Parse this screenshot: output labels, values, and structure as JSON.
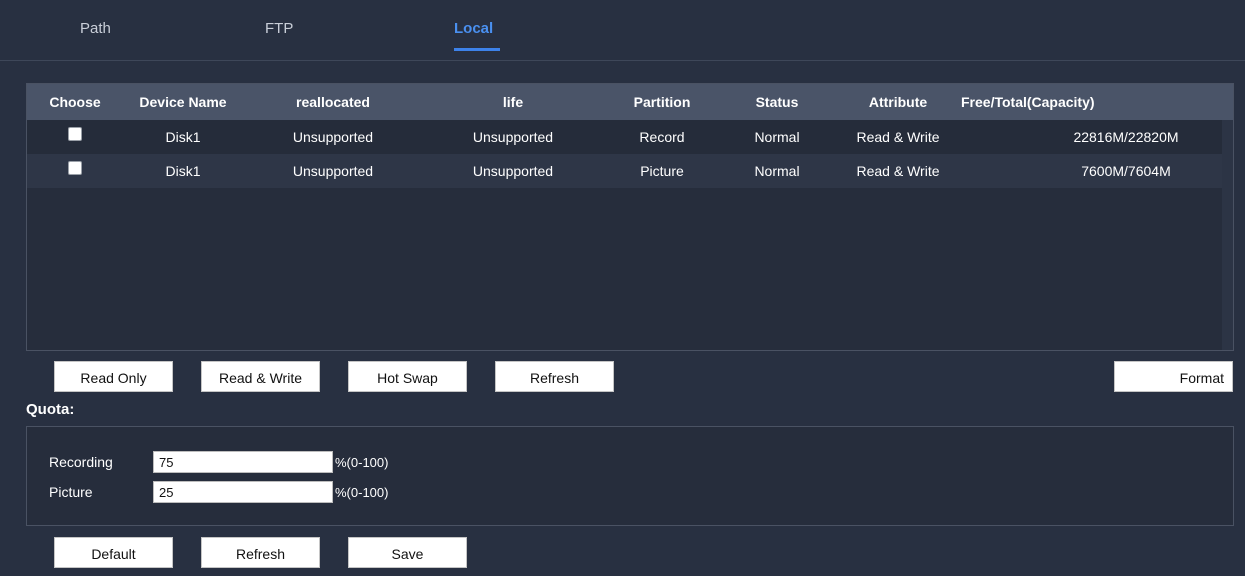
{
  "tabs": [
    {
      "label": "Path",
      "active": false
    },
    {
      "label": "FTP",
      "active": false
    },
    {
      "label": "Local",
      "active": true
    }
  ],
  "table": {
    "headers": [
      "Choose",
      "Device Name",
      "reallocated",
      "life",
      "Partition",
      "Status",
      "Attribute",
      "Free/Total(Capacity)"
    ],
    "rows": [
      {
        "choose": false,
        "device_name": "Disk1",
        "reallocated": "Unsupported",
        "life": "Unsupported",
        "partition": "Record",
        "status": "Normal",
        "attribute": "Read & Write",
        "capacity": "22816M/22820M"
      },
      {
        "choose": false,
        "device_name": "Disk1",
        "reallocated": "Unsupported",
        "life": "Unsupported",
        "partition": "Picture",
        "status": "Normal",
        "attribute": "Read & Write",
        "capacity": "7600M/7604M"
      }
    ]
  },
  "actions": {
    "read_only": "Read Only",
    "read_write": "Read & Write",
    "hot_swap": "Hot Swap",
    "refresh": "Refresh",
    "format": "Format"
  },
  "quota": {
    "title": "Quota:",
    "recording_label": "Recording",
    "recording_value": "75",
    "recording_unit": "%(0-100)",
    "picture_label": "Picture",
    "picture_value": "25",
    "picture_unit": "%(0-100)"
  },
  "footer": {
    "default": "Default",
    "refresh": "Refresh",
    "save": "Save"
  },
  "colors": {
    "background": "#283041",
    "accent": "#3d82ea",
    "header_row": "#4a5468"
  }
}
